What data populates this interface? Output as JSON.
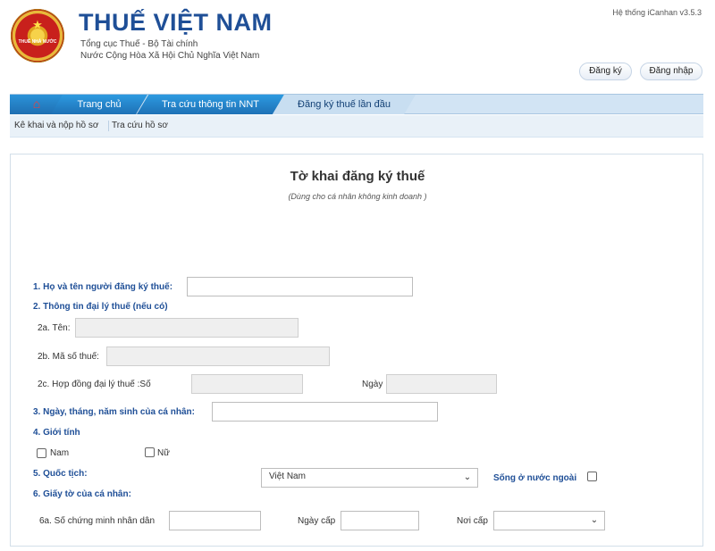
{
  "header": {
    "logo_text": "THUẾ NHÀ NƯỚC",
    "brand_title": "THUẾ VIỆT NAM",
    "brand_sub1": "Tổng cục Thuế - Bộ Tài chính",
    "brand_sub2": "Nước Cộng Hòa Xã Hội Chủ Nghĩa Việt Nam",
    "system_version": "Hệ thống iCanhan v3.5.3",
    "register_label": "Đăng ký",
    "login_label": "Đăng nhập"
  },
  "nav": {
    "home_icon": "home-icon",
    "items": [
      {
        "label": "Trang chủ"
      },
      {
        "label": "Tra cứu thông tin NNT"
      },
      {
        "label": "Đăng ký thuế lần đầu"
      }
    ]
  },
  "subnav": {
    "items": [
      {
        "label": "Kê khai và nộp hồ sơ"
      },
      {
        "label": "Tra cứu hồ sơ"
      }
    ]
  },
  "form": {
    "title": "Tờ khai đăng ký thuế",
    "subtitle": "(Dùng cho cá nhân không kinh doanh )",
    "field1_label": "1. Họ và tên người đăng ký thuế:",
    "field1_value": "",
    "section2_label": "2. Thông tin đại lý thuế (nếu có)",
    "field2a_label": "2a. Tên:",
    "field2b_label": "2b. Mã số thuế:",
    "field2c_label": "2c. Hợp đồng đại lý thuế :Số",
    "field2c_date_label": "Ngày",
    "field3_label": "3. Ngày, tháng, năm sinh của cá nhân:",
    "section4_label": "4. Giới tính",
    "gender_male": "Nam",
    "gender_female": "Nữ",
    "field5_label": "5. Quốc tịch:",
    "nationality_value": "Việt Nam",
    "living_abroad_label": "Sống ở nước ngoài",
    "section6_label": "6. Giấy tờ của cá nhân:",
    "field6a_label": "6a. Số chứng minh nhân dân",
    "issue_date_label": "Ngày cấp",
    "issue_place_label": "Nơi cấp",
    "issue_place_value": ""
  }
}
